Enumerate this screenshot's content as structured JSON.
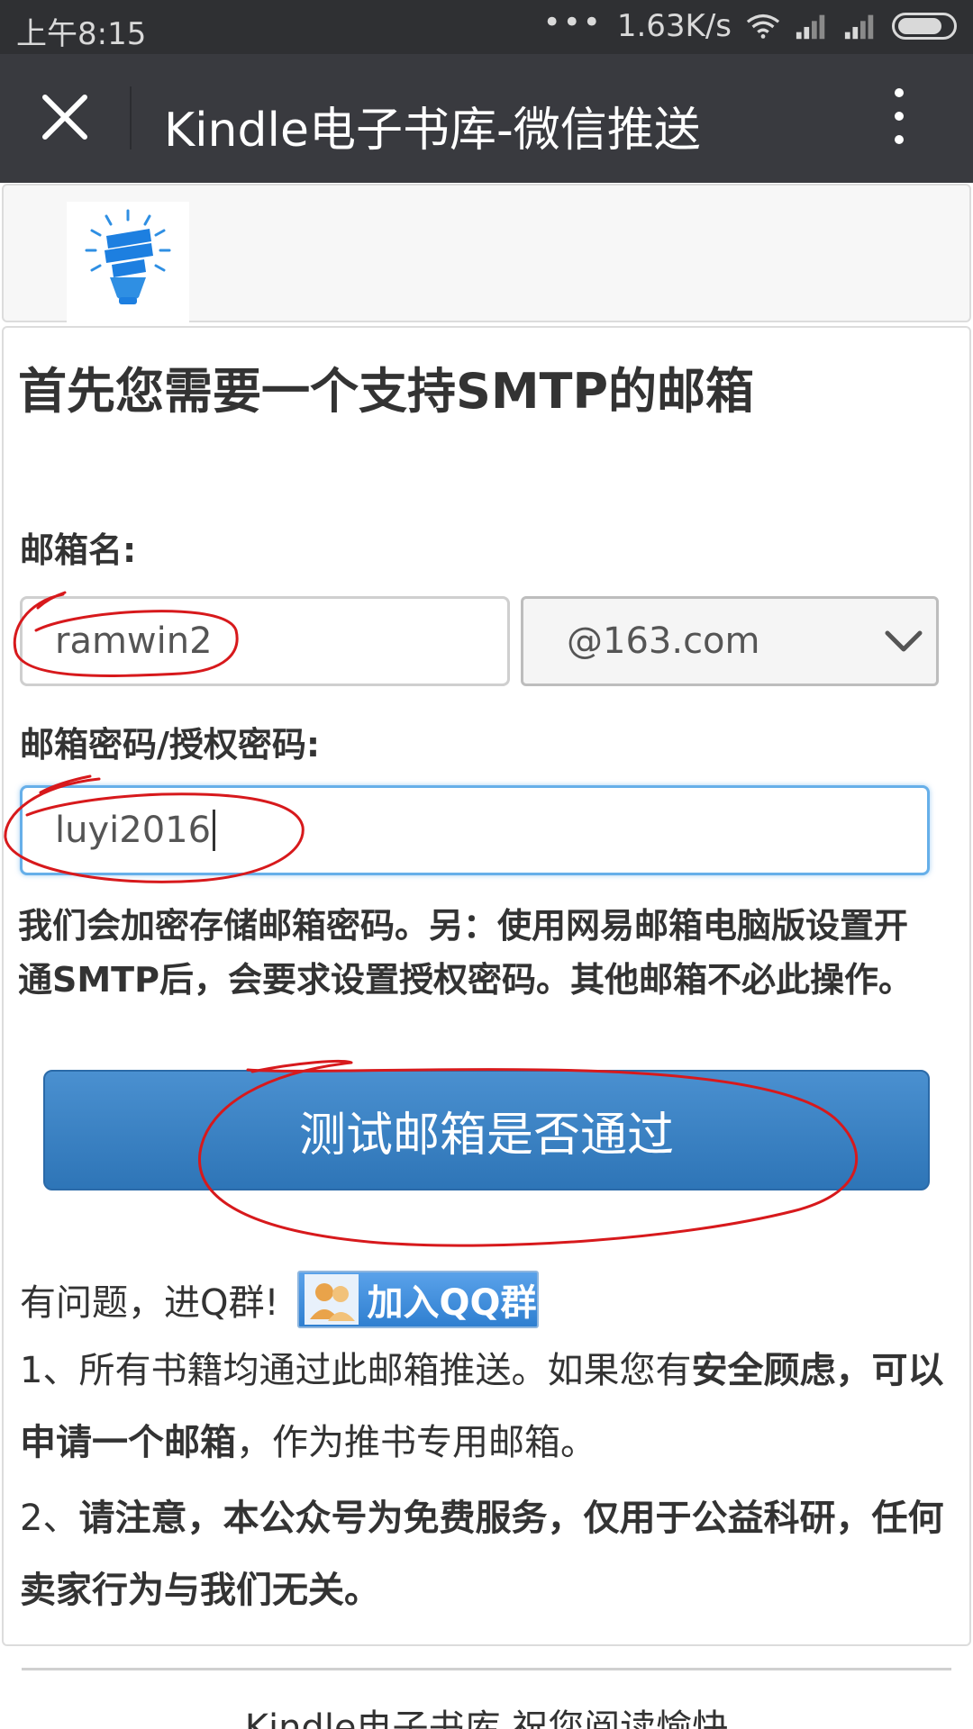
{
  "status_bar": {
    "time": "上午8:15",
    "dots": "•••",
    "speed": "1.63K/s"
  },
  "titlebar": {
    "title": "Kindle电子书库-微信推送"
  },
  "main": {
    "heading": "首先您需要一个支持SMTP的邮箱",
    "email_label": "邮箱名:",
    "email_value": "ramwin2",
    "domain_selected": "@163.com",
    "password_label": "邮箱密码/授权密码:",
    "password_value": "luyi2016",
    "help_text": "我们会加密存储邮箱密码。另：使用网易邮箱电脑版设置开通SMTP后，会要求设置授权密码。其他邮箱不必此操作。",
    "test_button": "测试邮箱是否通过",
    "qq_prompt": "有问题，进Q群!",
    "qq_button": "加入QQ群",
    "note1": {
      "prefix": "1、所有书籍均通过此邮箱推送。如果您有",
      "bold": "安全顾虑，可以申请一个邮箱",
      "suffix": "，作为推书专用邮箱。"
    },
    "note2": {
      "prefix": "2、",
      "bold": "请注意，本公众号为免费服务，仅用于公益科研，任何卖家行为与我们无关。"
    }
  },
  "footer": {
    "text": "Kindle电子书库 祝您阅读愉快"
  },
  "colors": {
    "statusbar_bg": "#2f3033",
    "titlebar_bg": "#393a3f",
    "button_blue": "#337ab7",
    "annotation_red": "#d7191c"
  }
}
